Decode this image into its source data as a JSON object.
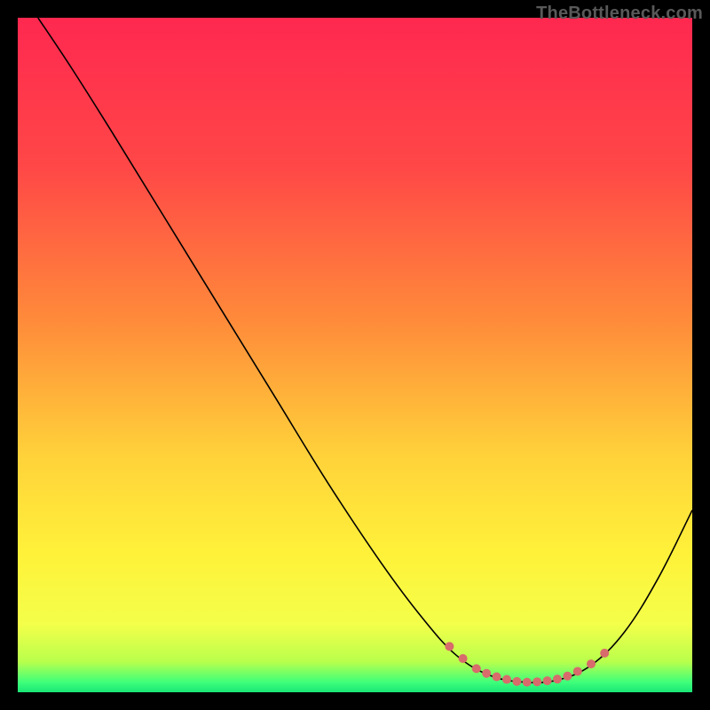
{
  "attribution": "TheBottleneck.com",
  "chart_data": {
    "type": "line",
    "title": "",
    "xlabel": "",
    "ylabel": "",
    "xlim": [
      0,
      100
    ],
    "ylim": [
      0,
      100
    ],
    "grid": false,
    "legend": false,
    "background_gradient": {
      "stops": [
        {
          "offset": 0.0,
          "color": "#ff2850"
        },
        {
          "offset": 0.22,
          "color": "#ff4747"
        },
        {
          "offset": 0.45,
          "color": "#ff8b3a"
        },
        {
          "offset": 0.65,
          "color": "#ffd23a"
        },
        {
          "offset": 0.8,
          "color": "#fff23a"
        },
        {
          "offset": 0.9,
          "color": "#f3ff4a"
        },
        {
          "offset": 0.955,
          "color": "#b8ff4c"
        },
        {
          "offset": 0.985,
          "color": "#3fff7a"
        },
        {
          "offset": 1.0,
          "color": "#18e676"
        }
      ]
    },
    "series": [
      {
        "name": "bottleneck-curve",
        "type": "line",
        "color": "#000000",
        "width": 1.6,
        "points": [
          {
            "x": 3,
            "y": 100
          },
          {
            "x": 8,
            "y": 92.5
          },
          {
            "x": 14,
            "y": 83
          },
          {
            "x": 22,
            "y": 70
          },
          {
            "x": 30,
            "y": 57
          },
          {
            "x": 38,
            "y": 44
          },
          {
            "x": 46,
            "y": 31
          },
          {
            "x": 54,
            "y": 19
          },
          {
            "x": 60,
            "y": 11
          },
          {
            "x": 65,
            "y": 5.5
          },
          {
            "x": 70,
            "y": 2.5
          },
          {
            "x": 75,
            "y": 1.5
          },
          {
            "x": 80,
            "y": 1.8
          },
          {
            "x": 85,
            "y": 4
          },
          {
            "x": 90,
            "y": 9
          },
          {
            "x": 95,
            "y": 17
          },
          {
            "x": 100,
            "y": 27
          }
        ]
      },
      {
        "name": "highlight-dots",
        "type": "scatter",
        "color": "#d86b6b",
        "radius": 5,
        "points": [
          {
            "x": 64,
            "y": 6.8
          },
          {
            "x": 66,
            "y": 5.0
          },
          {
            "x": 68,
            "y": 3.5
          },
          {
            "x": 69.5,
            "y": 2.8
          },
          {
            "x": 71,
            "y": 2.3
          },
          {
            "x": 72.5,
            "y": 1.9
          },
          {
            "x": 74,
            "y": 1.6
          },
          {
            "x": 75.5,
            "y": 1.5
          },
          {
            "x": 77,
            "y": 1.55
          },
          {
            "x": 78.5,
            "y": 1.7
          },
          {
            "x": 80,
            "y": 1.95
          },
          {
            "x": 81.5,
            "y": 2.4
          },
          {
            "x": 83,
            "y": 3.1
          },
          {
            "x": 85,
            "y": 4.2
          },
          {
            "x": 87,
            "y": 5.8
          }
        ]
      }
    ]
  }
}
